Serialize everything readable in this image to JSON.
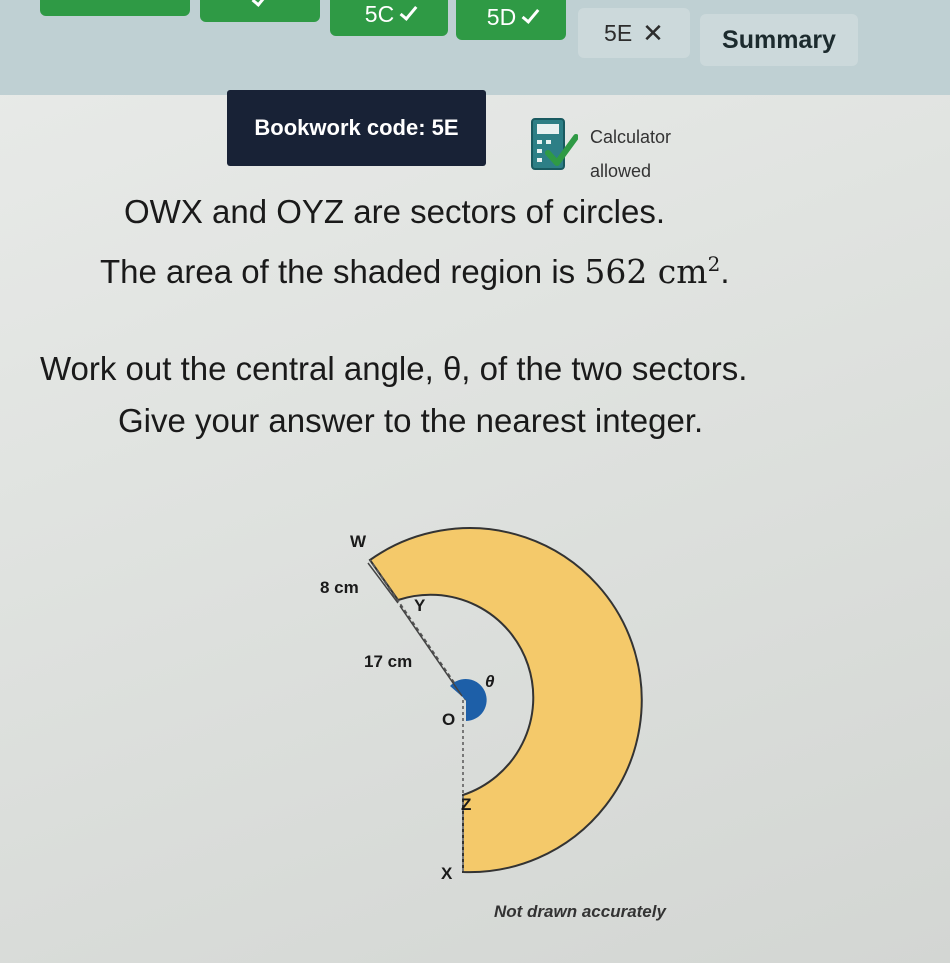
{
  "tabs": [
    {
      "label": "",
      "status": "correct"
    },
    {
      "label": "5C",
      "status": "correct"
    },
    {
      "label": "5D",
      "status": "correct"
    },
    {
      "label": "5E",
      "status": "incorrect"
    },
    {
      "label": "Summary",
      "status": "none"
    }
  ],
  "bookwork": {
    "label": "Bookwork code: 5E"
  },
  "calculator": {
    "line1": "Calculator",
    "line2": "allowed",
    "icon": "calculator-check-icon"
  },
  "question": {
    "line1": "OWX and OYZ are sectors of circles.",
    "line2_prefix": "The area of the shaded region is ",
    "line2_value": "562 cm",
    "line2_sup": "2",
    "line2_suffix": ".",
    "line3": "Work out the central angle, θ, of the two sectors.",
    "line4": "Give your answer to the nearest integer."
  },
  "diagram": {
    "labels": {
      "W": "W",
      "Y": "Y",
      "O": "O",
      "Z": "Z",
      "X": "X",
      "theta": "θ"
    },
    "outer_length": "8 cm",
    "inner_length": "17 cm",
    "shade_color": "#f4c96a",
    "angle_color": "#1d5fa8"
  },
  "note": "Not drawn accurately"
}
